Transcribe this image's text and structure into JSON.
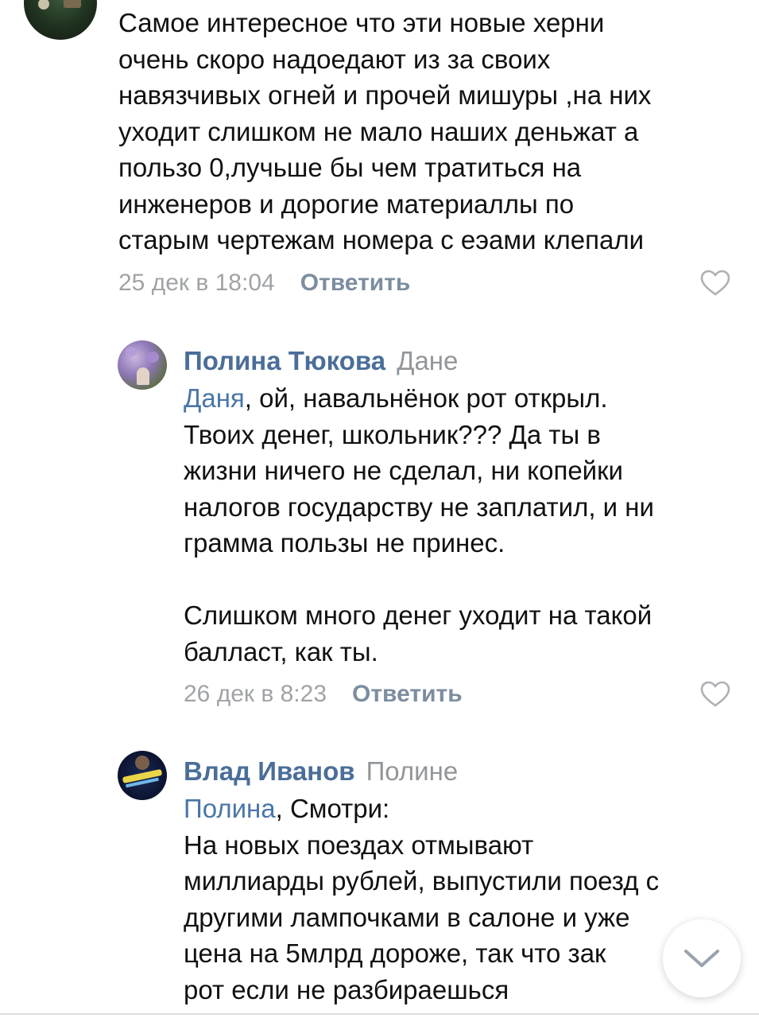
{
  "comments": [
    {
      "author": "",
      "text": "Самое интересное что эти новые херни\nочень скоро надоедают из за своих\nнавязчивых огней и прочей мишуры ,на них\nуходит слишком не мало наших деньжат а\nпользо 0,лучьше бы чем тратиться на\nинженеров и дорогие материаллы по\nстарым чертежам номера с еэами клепали",
      "time": "25 дек в 18:04",
      "reply_label": "Ответить"
    },
    {
      "author": "Полина Тюкова",
      "reply_to": "Дане",
      "mention": "Даня",
      "text": ", ой, навальнёнок рот открыл.\nТвоих денег, школьник??? Да ты в\nжизни ничего не сделал, ни копейки\nналогов государству не заплатил, и ни\nграмма пользы не принес.\n\nСлишком много денег уходит на такой\nбалласт, как ты.",
      "time": "26 дек в 8:23",
      "reply_label": "Ответить"
    },
    {
      "author": "Влад Иванов",
      "reply_to": "Полине",
      "mention": "Полина",
      "text": ", Смотри:\nНа новых поездах отмывают\nмиллиарды рублей, выпустили поезд с\nдругими лампочками в салоне и уже\nцена на 5млрд дороже, так что зак\nрот если не разбираешься"
    }
  ],
  "icons": {
    "like": "heart-outline-icon",
    "scroll_down": "chevron-down-icon"
  },
  "colors": {
    "author": "#4a6e99",
    "mention": "#4a76a8",
    "muted": "#939699",
    "reply_button": "#7c8d9f",
    "icon": "#aeb1b5"
  }
}
